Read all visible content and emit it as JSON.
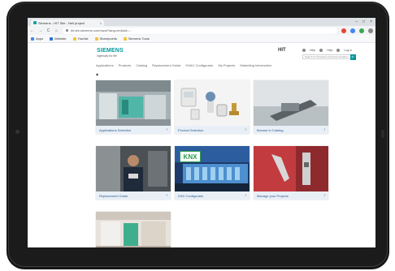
{
  "browser": {
    "tab_title": "Siemens - HIT Site - Neli project",
    "tab_close": "×",
    "window_controls": [
      "–",
      "□",
      "×"
    ],
    "nav_back": "←",
    "nav_forward": "→",
    "nav_reload": "C",
    "nav_home": "⌂",
    "url": "hit.sbt.siemens.com/nwa/?lang=en&sid=…",
    "bookmarks": [
      {
        "label": "Apps",
        "icon": "apps-icon",
        "color": "#4285f4"
      },
      {
        "label": "Website",
        "icon": "bookmark-icon",
        "color": "#2a6fd6"
      },
      {
        "label": "Yourlist",
        "icon": "folder-icon",
        "color": "#f3c33b"
      },
      {
        "label": "Sharepoints",
        "icon": "folder-icon",
        "color": "#f3c33b"
      },
      {
        "label": "Siemens Tools",
        "icon": "folder-icon",
        "color": "#f3c33b"
      }
    ]
  },
  "header": {
    "brand": "SIEMENS",
    "tagline": "Ingenuity for life",
    "app_name": "HIT",
    "util_links": [
      "Help",
      "Help",
      "Log in"
    ],
    "search_placeholder": "Search for Products and Documentation",
    "search_icon": "🔍"
  },
  "nav": {
    "items": [
      "Applications",
      "Products",
      "Catalog",
      "Replacement Guide",
      "HVAC Configurator",
      "My Projects",
      "Marketing Information"
    ]
  },
  "breadcrumb": "◆",
  "tiles": [
    {
      "label": "Applications Selection",
      "arrow": "›"
    },
    {
      "label": "Product Selection",
      "arrow": "›"
    },
    {
      "label": "Browse in Catalog",
      "arrow": "›"
    },
    {
      "label": "Replacement Guide",
      "arrow": "›"
    },
    {
      "label": "KNX Configurator",
      "arrow": "›",
      "badge": "KNX"
    },
    {
      "label": "Manage your Projects",
      "arrow": "›"
    },
    {
      "label": "",
      "arrow": ""
    }
  ],
  "colors": {
    "brand": "#009999",
    "caption_bg": "#e9eff6",
    "caption_text": "#2c5a8a"
  }
}
